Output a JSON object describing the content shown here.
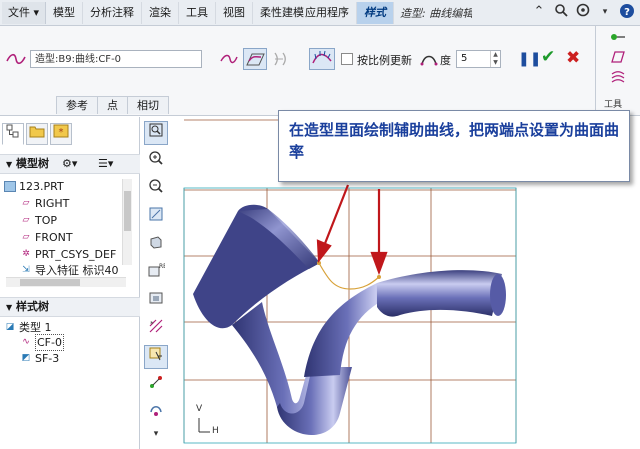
{
  "menubar": {
    "file": "文件",
    "items": [
      "模型",
      "分析注释",
      "渲染",
      "工具",
      "视图",
      "柔性建模",
      "应用程序"
    ],
    "active_tab": "样式",
    "mode_title": "造型: 曲线编辑"
  },
  "ribbon": {
    "curve_field": "造型:B9:曲线:CF-0",
    "proportional_update_label": "按比例更新",
    "degree_label": "度",
    "degree_value": "5",
    "tabs": [
      "参考",
      "点",
      "相切"
    ],
    "side_tools_label": "工具"
  },
  "left_panel": {
    "model_tree_header": "模型树",
    "model_tree_items": [
      "123.PRT",
      "RIGHT",
      "TOP",
      "FRONT",
      "PRT_CSYS_DEF",
      "导入特征 标识40"
    ],
    "style_tree_header": "样式树",
    "style_tree_items": [
      "类型 1",
      "CF-0",
      "SF-3"
    ]
  },
  "canvas": {
    "annotation_text": "在造型里面绘制辅助曲线，把两端点设置为曲面曲率",
    "axis_v": "V",
    "axis_h": "H"
  },
  "colors": {
    "annotation_text": "#1a3f9c",
    "arrow": "#c0171b",
    "grid": "#9b5a3a",
    "pipe": "#4a4f94",
    "aux_curve": "#d8a23a",
    "ok": "#1d9a2b",
    "cancel": "#cc2020"
  }
}
